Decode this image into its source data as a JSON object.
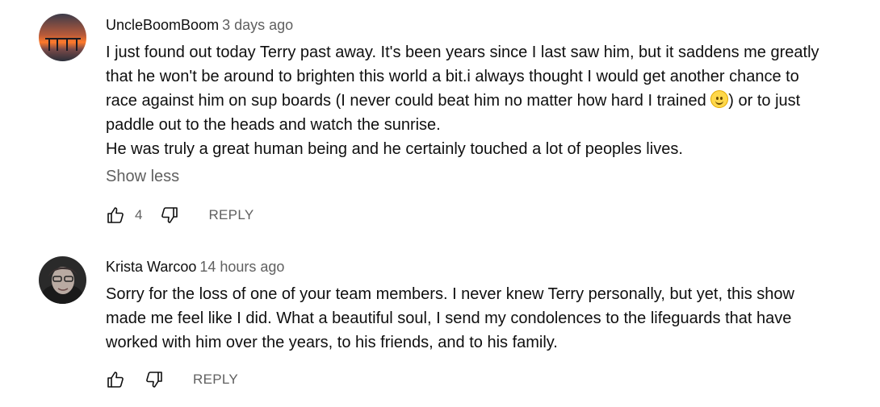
{
  "comments": [
    {
      "author": "UncleBoomBoom",
      "time": "3 days ago",
      "avatar": "sunset-pier-avatar",
      "text_line1": "I just found out today Terry past away. It's been years since I last saw him, but it saddens me greatly that he won't be around to brighten this world a bit.i always thought I would get another chance to race against him on sup boards (I never could beat him no matter how hard I trained ",
      "emoji": "slightly-smiling-face",
      "text_line1_end": ") or to just paddle out to the heads and watch the sunrise.",
      "text_line2": "He was truly a great human being and he certainly touched a lot of peoples lives.",
      "show_less": "Show less",
      "likes": "4",
      "reply": "REPLY"
    },
    {
      "author": "Krista Warcoo",
      "time": "14 hours ago",
      "avatar": "woman-glasses-avatar",
      "text": "Sorry for the loss of one of your team members. I never knew Terry personally, but yet, this show made me feel like I did. What a beautiful soul, I send my condolences to the lifeguards that have worked with him over the years, to his friends, and to his family.",
      "reply": "REPLY"
    }
  ],
  "icons": {
    "like": "thumbs-up-icon",
    "dislike": "thumbs-down-icon"
  },
  "colors": {
    "text": "#0f0f0f",
    "secondary": "#606060"
  }
}
